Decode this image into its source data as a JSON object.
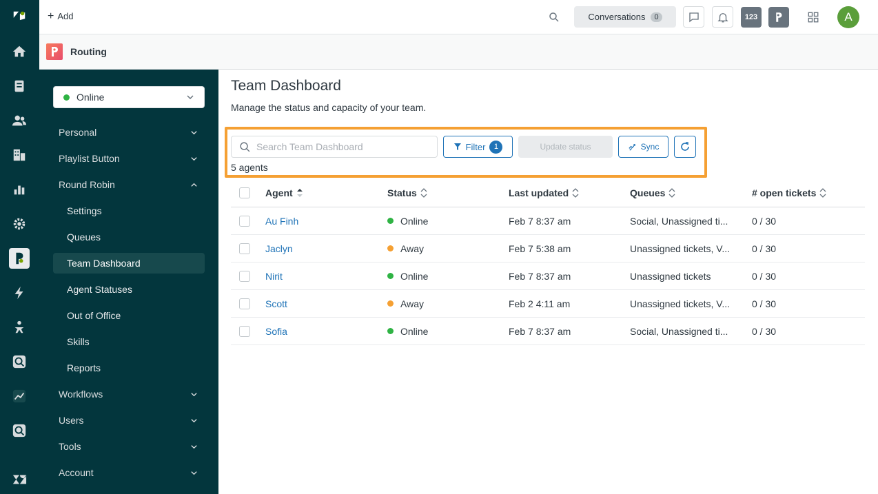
{
  "topbar": {
    "add_label": "Add",
    "conversations_label": "Conversations",
    "conversations_count": "0",
    "badge_123": "123",
    "avatar_initial": "A"
  },
  "app": {
    "title": "Routing"
  },
  "sidebar": {
    "status": "Online",
    "items": [
      {
        "label": "Personal"
      },
      {
        "label": "Playlist Button"
      },
      {
        "label": "Round Robin"
      },
      {
        "label": "Settings"
      },
      {
        "label": "Queues"
      },
      {
        "label": "Team Dashboard"
      },
      {
        "label": "Agent Statuses"
      },
      {
        "label": "Out of Office"
      },
      {
        "label": "Skills"
      },
      {
        "label": "Reports"
      },
      {
        "label": "Workflows"
      },
      {
        "label": "Users"
      },
      {
        "label": "Tools"
      },
      {
        "label": "Account"
      }
    ]
  },
  "main": {
    "title": "Team Dashboard",
    "subtitle": "Manage the status and capacity of your team.",
    "search_placeholder": "Search Team Dashboard",
    "filter_label": "Filter",
    "filter_count": "1",
    "update_status_label": "Update status",
    "sync_label": "Sync",
    "agent_count": "5 agents"
  },
  "table": {
    "headers": {
      "agent": "Agent",
      "status": "Status",
      "last_updated": "Last updated",
      "queues": "Queues",
      "open_tickets": "# open tickets"
    },
    "rows": [
      {
        "agent": "Au Finh",
        "status": "Online",
        "last_updated": "Feb 7 8:37 am",
        "queues": "Social, Unassigned ti...",
        "open_tickets": "0 / 30"
      },
      {
        "agent": "Jaclyn",
        "status": "Away",
        "last_updated": "Feb 7 5:38 am",
        "queues": "Unassigned tickets, V...",
        "open_tickets": "0 / 30"
      },
      {
        "agent": "Nirit",
        "status": "Online",
        "last_updated": "Feb 7 8:37 am",
        "queues": "Unassigned tickets",
        "open_tickets": "0 / 30"
      },
      {
        "agent": "Scott",
        "status": "Away",
        "last_updated": "Feb 2 4:11 am",
        "queues": "Unassigned tickets, V...",
        "open_tickets": "0 / 30"
      },
      {
        "agent": "Sofia",
        "status": "Online",
        "last_updated": "Feb 7 8:37 am",
        "queues": "Social, Unassigned ti...",
        "open_tickets": "0 / 30"
      }
    ]
  },
  "colors": {
    "online": "#2fb344",
    "away": "#f5a033",
    "accent": "#1f73b7",
    "highlight": "#f5a033"
  }
}
